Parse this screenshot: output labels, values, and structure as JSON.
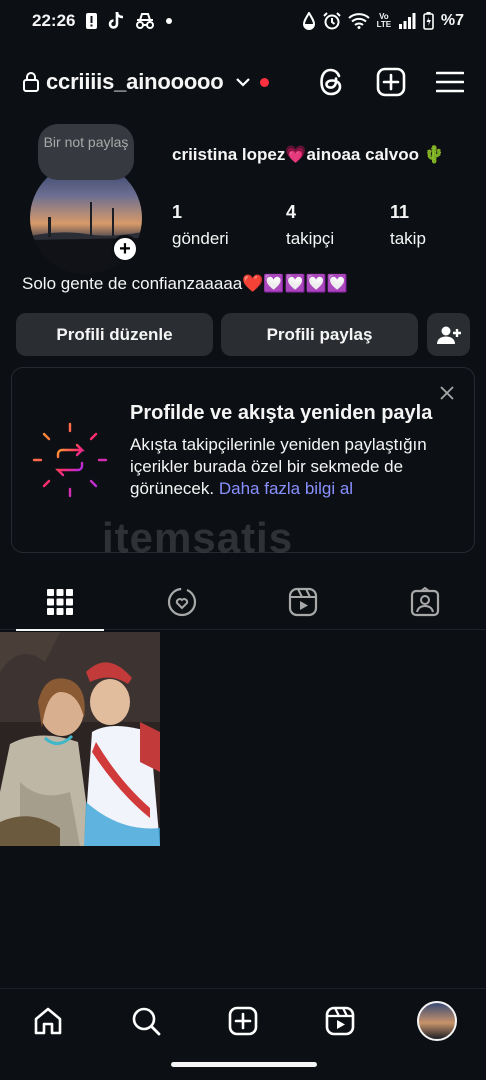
{
  "status_bar": {
    "time": "22:26",
    "battery": "%7",
    "volte": "Vo LTE"
  },
  "header": {
    "username": "ccriiiis_ainooooo"
  },
  "profile": {
    "note": "Bir not paylaş",
    "full_name": "criistina lopez💗ainoaa calvoo 🌵",
    "stats": [
      {
        "value": "1",
        "label": "gönderi"
      },
      {
        "value": "4",
        "label": "takipçi"
      },
      {
        "value": "11",
        "label": "takip"
      }
    ],
    "bio": "Solo gente de confianzaaaaa❤️💟💟💟💟"
  },
  "actions": {
    "edit_profile": "Profili düzenle",
    "share_profile": "Profili paylaş"
  },
  "repost_card": {
    "title": "Profilde ve akışta yeniden payla",
    "description": "Akışta takipçilerinle yeniden paylaştığın içerikler burada özel bir sekmede de görünecek.",
    "link": "Daha fazla bilgi al"
  },
  "watermark": "itemsatis",
  "tabs": [
    {
      "icon": "grid-icon",
      "active": true
    },
    {
      "icon": "repost-icon",
      "active": false
    },
    {
      "icon": "reels-icon",
      "active": false
    },
    {
      "icon": "tagged-icon",
      "active": false
    }
  ],
  "posts_count_shown": 1,
  "bottom_nav": [
    "home-icon",
    "search-icon",
    "create-icon",
    "reels-icon",
    "profile-avatar"
  ],
  "colors": {
    "background": "#0c1014",
    "button": "#2a2e33",
    "link": "#8a8fff",
    "notification_dot": "#ff3040"
  }
}
